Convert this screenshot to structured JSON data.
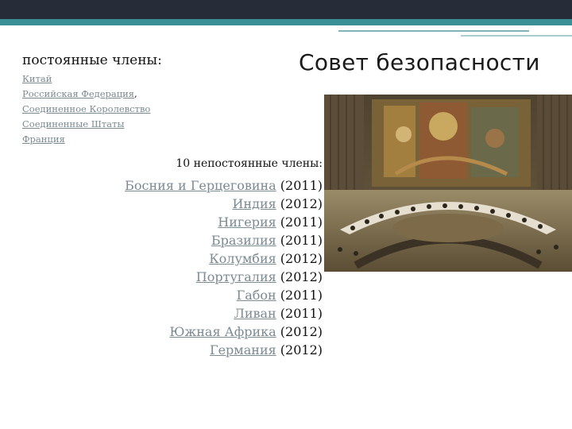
{
  "slide": {
    "title": "Совет безопасности"
  },
  "permanent": {
    "heading": "постоянные члены:",
    "members": [
      "Китай",
      "Российская Федерация",
      "Соединенное Королевство",
      "Соединенные Штаты",
      "Франция"
    ]
  },
  "non_permanent": {
    "heading": "10 непостоянные члены:",
    "members": [
      {
        "name": "Босния и Герцеговина",
        "year": "(2011)"
      },
      {
        "name": "Индия",
        "year": "(2012)"
      },
      {
        "name": "Нигерия",
        "year": "(2011)"
      },
      {
        "name": "Бразилия",
        "year": "(2011)"
      },
      {
        "name": "Колумбия",
        "year": "(2012)"
      },
      {
        "name": "Португалия",
        "year": "(2012)"
      },
      {
        "name": "Габон",
        "year": "(2011)"
      },
      {
        "name": "Ливан",
        "year": "(2011)"
      },
      {
        "name": "Южная Африка",
        "year": "(2012)"
      },
      {
        "name": "Германия",
        "year": "(2012)"
      }
    ]
  },
  "photo": {
    "icon": "security-council-chamber-photo"
  },
  "colors": {
    "top_bar": "#262d38",
    "accent": "#3a8f96",
    "link": "#7c8a92"
  }
}
